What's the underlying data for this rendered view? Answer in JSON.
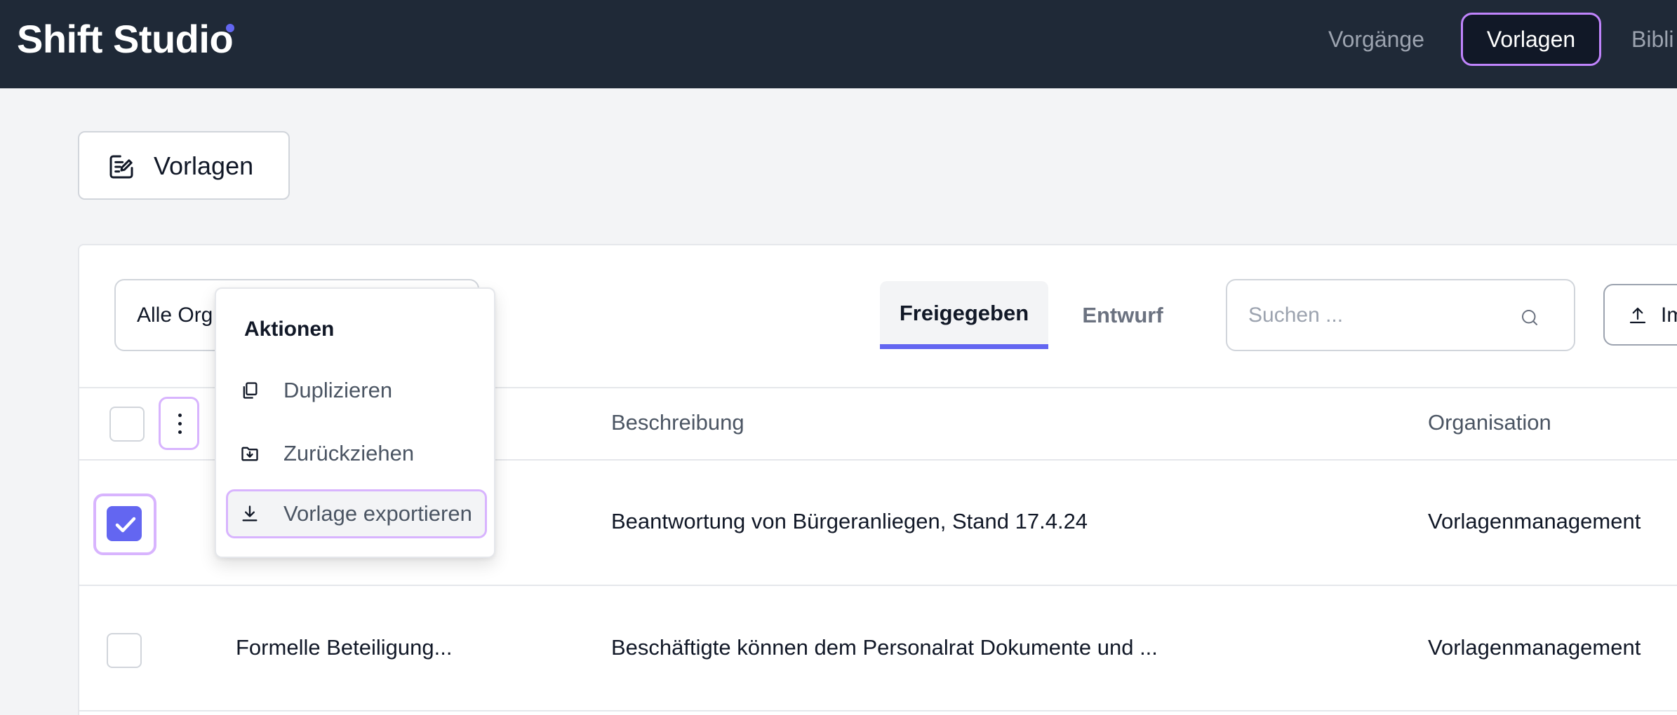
{
  "app": {
    "brand": "Shift Studio",
    "accent_color": "#6366f1",
    "header_bg": "#1f2937"
  },
  "nav": {
    "items": [
      {
        "label": "Vorgänge",
        "active": false
      },
      {
        "label": "Vorlagen",
        "active": true
      },
      {
        "label": "Bibli",
        "active": false
      }
    ]
  },
  "page": {
    "title": "Vorlagen",
    "title_icon": "edit-document-icon"
  },
  "toolbar": {
    "org_filter_value": "Alle Org",
    "tabs": [
      {
        "label": "Freigegeben",
        "active": true
      },
      {
        "label": "Entwurf",
        "active": false
      }
    ],
    "search_placeholder": "Suchen ...",
    "import_label": "Im"
  },
  "table": {
    "columns": [
      "Beschreibung",
      "Organisation"
    ],
    "rows": [
      {
        "selected": true,
        "name": "",
        "description": "Beantwortung von Bürgeranliegen, Stand 17.4.24",
        "organisation": "Vorlagenmanagement"
      },
      {
        "selected": false,
        "name": "Formelle Beteiligung...",
        "description": "Beschäftigte können dem Personalrat Dokumente und ...",
        "organisation": "Vorlagenmanagement"
      }
    ]
  },
  "actions_menu": {
    "title": "Aktionen",
    "items": [
      {
        "label": "Duplizieren",
        "icon": "copy-icon"
      },
      {
        "label": "Zurückziehen",
        "icon": "folder-download-icon"
      },
      {
        "label": "Vorlage exportieren",
        "icon": "download-icon",
        "highlighted": true
      }
    ]
  }
}
